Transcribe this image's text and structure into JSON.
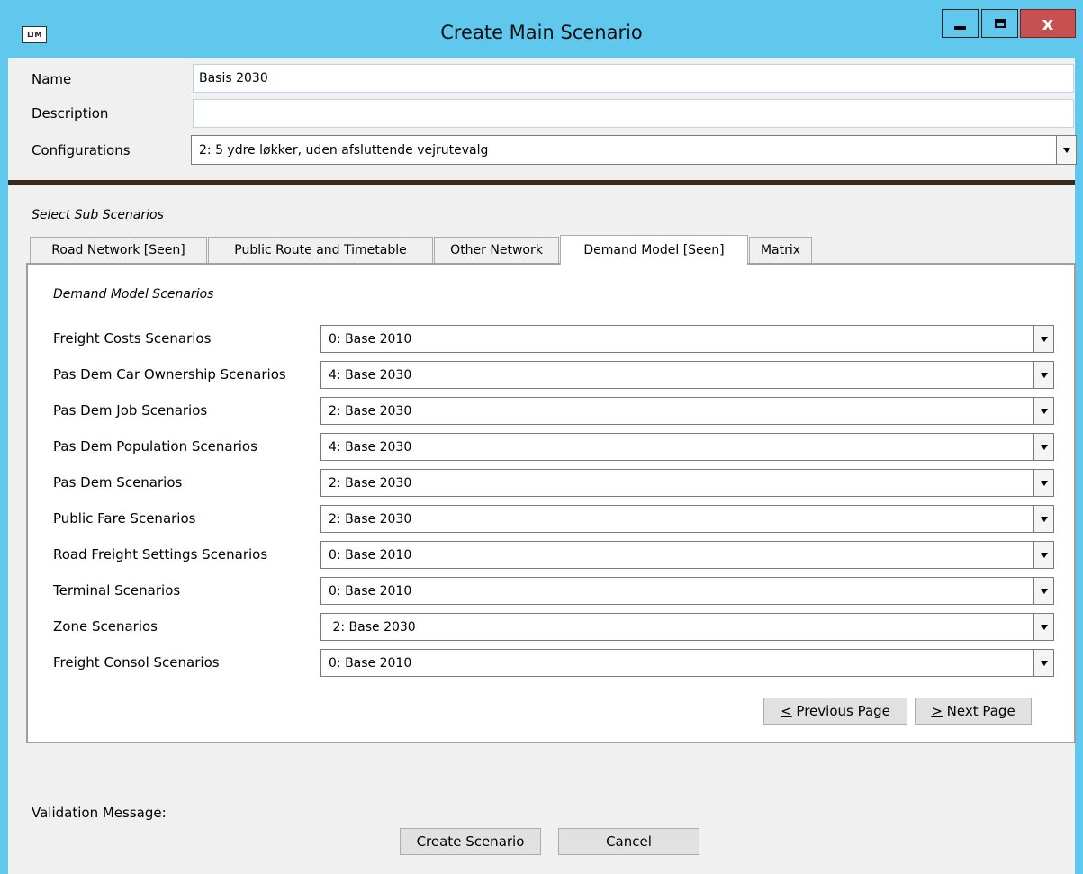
{
  "window": {
    "app_icon_text": "LTM",
    "title": "Create Main Scenario",
    "controls": {
      "close_glyph": "x"
    }
  },
  "form": {
    "name_label": "Name",
    "name_value": "Basis 2030",
    "description_label": "Description",
    "description_value": "",
    "configurations_label": "Configurations",
    "configurations_value": "2: 5 ydre løkker, uden afsluttende vejrutevalg"
  },
  "sub_scenarios": {
    "section_label": "Select Sub Scenarios",
    "tabs": [
      {
        "label": "Road Network [Seen]"
      },
      {
        "label": "Public Route and Timetable"
      },
      {
        "label": "Other Network"
      },
      {
        "label": "Demand Model [Seen]"
      },
      {
        "label": "Matrix"
      }
    ],
    "active_tab": "Demand Model [Seen]",
    "panel": {
      "heading": "Demand Model Scenarios",
      "rows": [
        {
          "label": "Freight Costs Scenarios",
          "value": "0: Base 2010"
        },
        {
          "label": "Pas Dem Car Ownership Scenarios",
          "value": "4: Base 2030"
        },
        {
          "label": "Pas Dem Job Scenarios",
          "value": "2: Base 2030"
        },
        {
          "label": "Pas Dem Population Scenarios",
          "value": "4: Base 2030"
        },
        {
          "label": "Pas Dem Scenarios",
          "value": "2: Base 2030"
        },
        {
          "label": "Public Fare Scenarios",
          "value": "2: Base 2030"
        },
        {
          "label": "Road Freight Settings Scenarios",
          "value": "0: Base 2010"
        },
        {
          "label": "Terminal Scenarios",
          "value": "0: Base 2010"
        },
        {
          "label": "Zone Scenarios",
          "value": " 2: Base 2030"
        },
        {
          "label": "Freight Consol Scenarios",
          "value": "0: Base 2010"
        }
      ],
      "prev_button": {
        "key": "<",
        "rest": " Previous Page"
      },
      "next_button": {
        "key": ">",
        "rest": " Next Page"
      }
    }
  },
  "footer": {
    "validation_label": "Validation Message:",
    "create_button": "Create Scenario",
    "cancel_button": "Cancel"
  },
  "colors": {
    "titlebar": "#60c8ec",
    "client_bg": "#f0f0f0",
    "close_button": "#c75050"
  }
}
